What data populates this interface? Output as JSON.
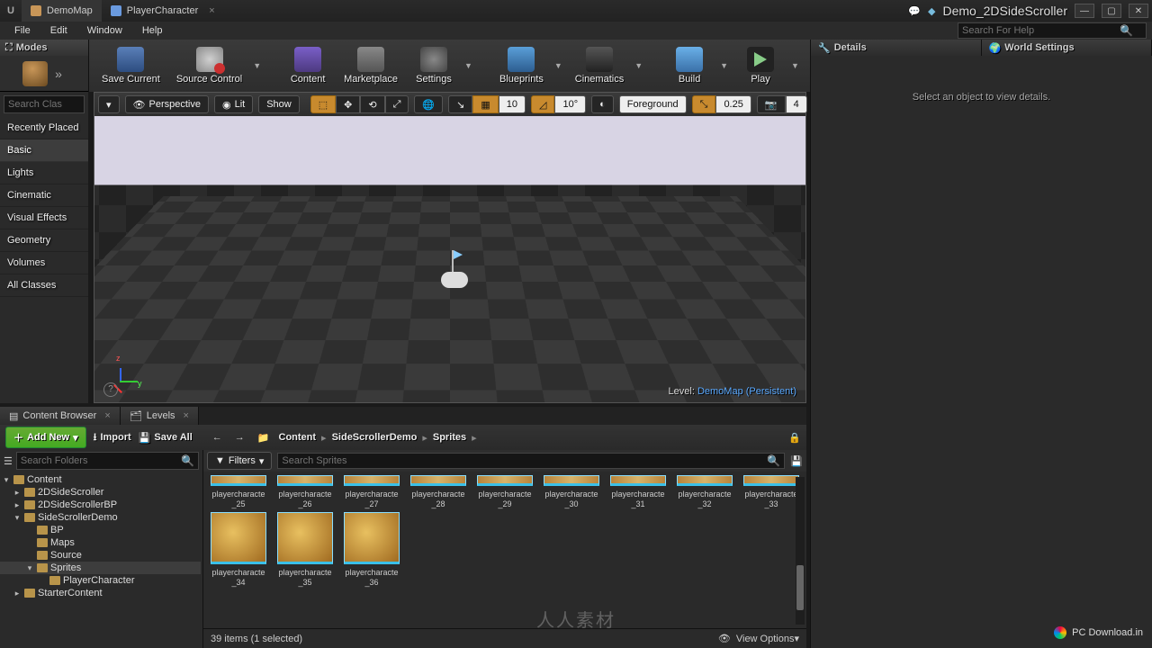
{
  "titlebar": {
    "tabs": [
      {
        "label": "DemoMap",
        "active": true
      },
      {
        "label": "PlayerCharacter",
        "active": false
      }
    ],
    "project": "Demo_2DSideScroller"
  },
  "menu": {
    "items": [
      "File",
      "Edit",
      "Window",
      "Help"
    ],
    "help_placeholder": "Search For Help"
  },
  "modes": {
    "title": "Modes",
    "search_placeholder": "Search Clas",
    "categories": [
      "Recently Placed",
      "Basic",
      "Lights",
      "Cinematic",
      "Visual Effects",
      "Geometry",
      "Volumes",
      "All Classes"
    ],
    "selected": "Basic"
  },
  "toolbar": {
    "save": "Save Current",
    "source": "Source Control",
    "content": "Content",
    "market": "Marketplace",
    "settings": "Settings",
    "blueprints": "Blueprints",
    "cinematics": "Cinematics",
    "build": "Build",
    "play": "Play"
  },
  "viewport": {
    "perspective": "Perspective",
    "lit": "Lit",
    "show": "Show",
    "grid": "10",
    "angle": "10°",
    "layer": "Foreground",
    "scale": "0.25",
    "cam": "4",
    "axis_z": "z",
    "axis_y": "y",
    "status_label": "Level:",
    "status_value": "DemoMap (Persistent)"
  },
  "right": {
    "details": "Details",
    "world": "World Settings",
    "placeholder": "Select an object to view details."
  },
  "bottom": {
    "tabs": {
      "content_browser": "Content Browser",
      "levels": "Levels"
    },
    "add_new": "Add New",
    "import": "Import",
    "save_all": "Save All",
    "folders_placeholder": "Search Folders",
    "filters": "Filters",
    "assets_placeholder": "Search Sprites",
    "breadcrumbs": [
      "Content",
      "SideScrollerDemo",
      "Sprites"
    ],
    "tree": [
      {
        "name": "Content",
        "depth": 0,
        "expand": "▾"
      },
      {
        "name": "2DSideScroller",
        "depth": 1,
        "expand": "▸"
      },
      {
        "name": "2DSideScrollerBP",
        "depth": 1,
        "expand": "▸"
      },
      {
        "name": "SideScrollerDemo",
        "depth": 1,
        "expand": "▾"
      },
      {
        "name": "BP",
        "depth": 2,
        "expand": ""
      },
      {
        "name": "Maps",
        "depth": 2,
        "expand": ""
      },
      {
        "name": "Source",
        "depth": 2,
        "expand": ""
      },
      {
        "name": "Sprites",
        "depth": 2,
        "expand": "▾",
        "selected": true
      },
      {
        "name": "PlayerCharacter",
        "depth": 3,
        "expand": ""
      },
      {
        "name": "StarterContent",
        "depth": 1,
        "expand": "▸"
      }
    ],
    "row1_suffixes": [
      "_25",
      "_26",
      "_27",
      "_28",
      "_29",
      "_30",
      "_31",
      "_32",
      "_33"
    ],
    "row2_suffixes": [
      "_34",
      "_35",
      "_36"
    ],
    "asset_name_stub": "playercharacte",
    "status": "39 items (1 selected)",
    "view_options": "View Options"
  },
  "watermark": "人人素材",
  "download_badge": "PC Download.in"
}
